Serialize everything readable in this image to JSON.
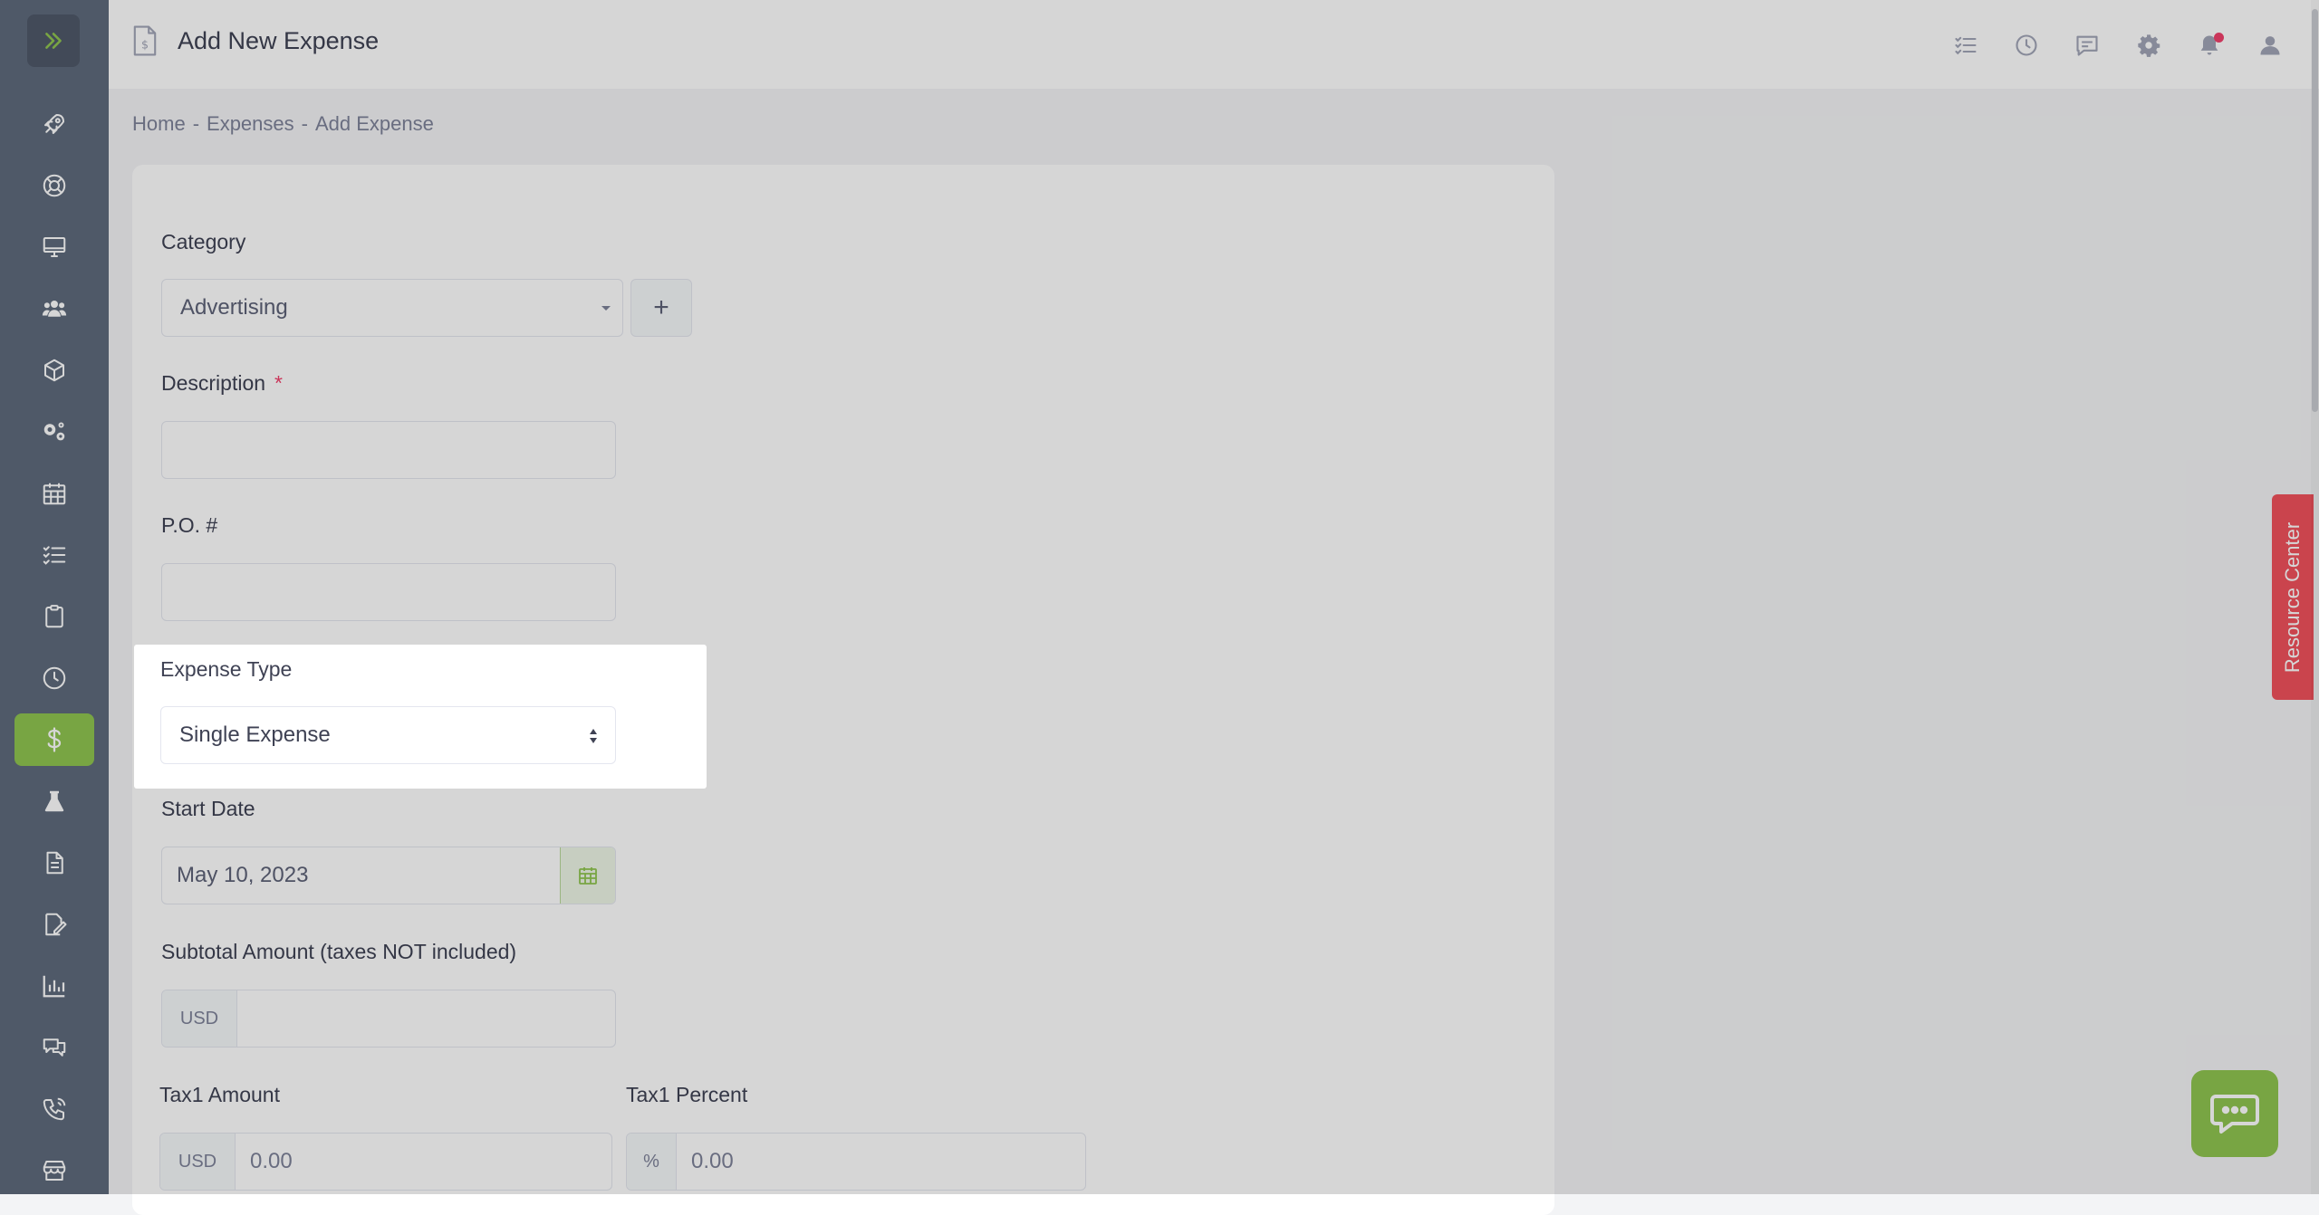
{
  "header": {
    "title": "Add New Expense"
  },
  "breadcrumb": {
    "home": "Home",
    "expenses": "Expenses",
    "current": "Add Expense",
    "separator": "-"
  },
  "form": {
    "category": {
      "label": "Category",
      "value": "Advertising",
      "add_symbol": "+"
    },
    "description": {
      "label": "Description",
      "required_mark": "*"
    },
    "po_number": {
      "label": "P.O. #"
    },
    "expense_type": {
      "label": "Expense Type",
      "value": "Single Expense"
    },
    "start_date": {
      "label": "Start Date",
      "value": "May 10, 2023"
    },
    "subtotal": {
      "label": "Subtotal Amount (taxes NOT included)",
      "currency": "USD"
    },
    "tax1_amount": {
      "label": "Tax1 Amount",
      "currency": "USD",
      "value": "0.00"
    },
    "tax1_percent": {
      "label": "Tax1 Percent",
      "symbol": "%",
      "value": "0.00"
    }
  },
  "resource_center": {
    "label": "Resource Center"
  },
  "colors": {
    "accent": "#8fc550",
    "sidebar": "#5f6b7d",
    "notification": "#f1416c",
    "resource_center": "#f1515c"
  },
  "sidebar_icons": [
    "rocket-icon",
    "lifebuoy-icon",
    "monitor-icon",
    "users-icon",
    "box-icon",
    "gears-icon",
    "calendar-icon",
    "checklist-icon",
    "clipboard-icon",
    "clock-icon",
    "dollar-icon",
    "flask-icon",
    "document-icon",
    "signature-icon",
    "chart-icon",
    "chat-icon",
    "phone-icon",
    "store-icon"
  ],
  "topbar_icons": [
    "tasks-icon",
    "clock-icon",
    "message-icon",
    "gear-icon",
    "bell-icon",
    "user-icon"
  ]
}
